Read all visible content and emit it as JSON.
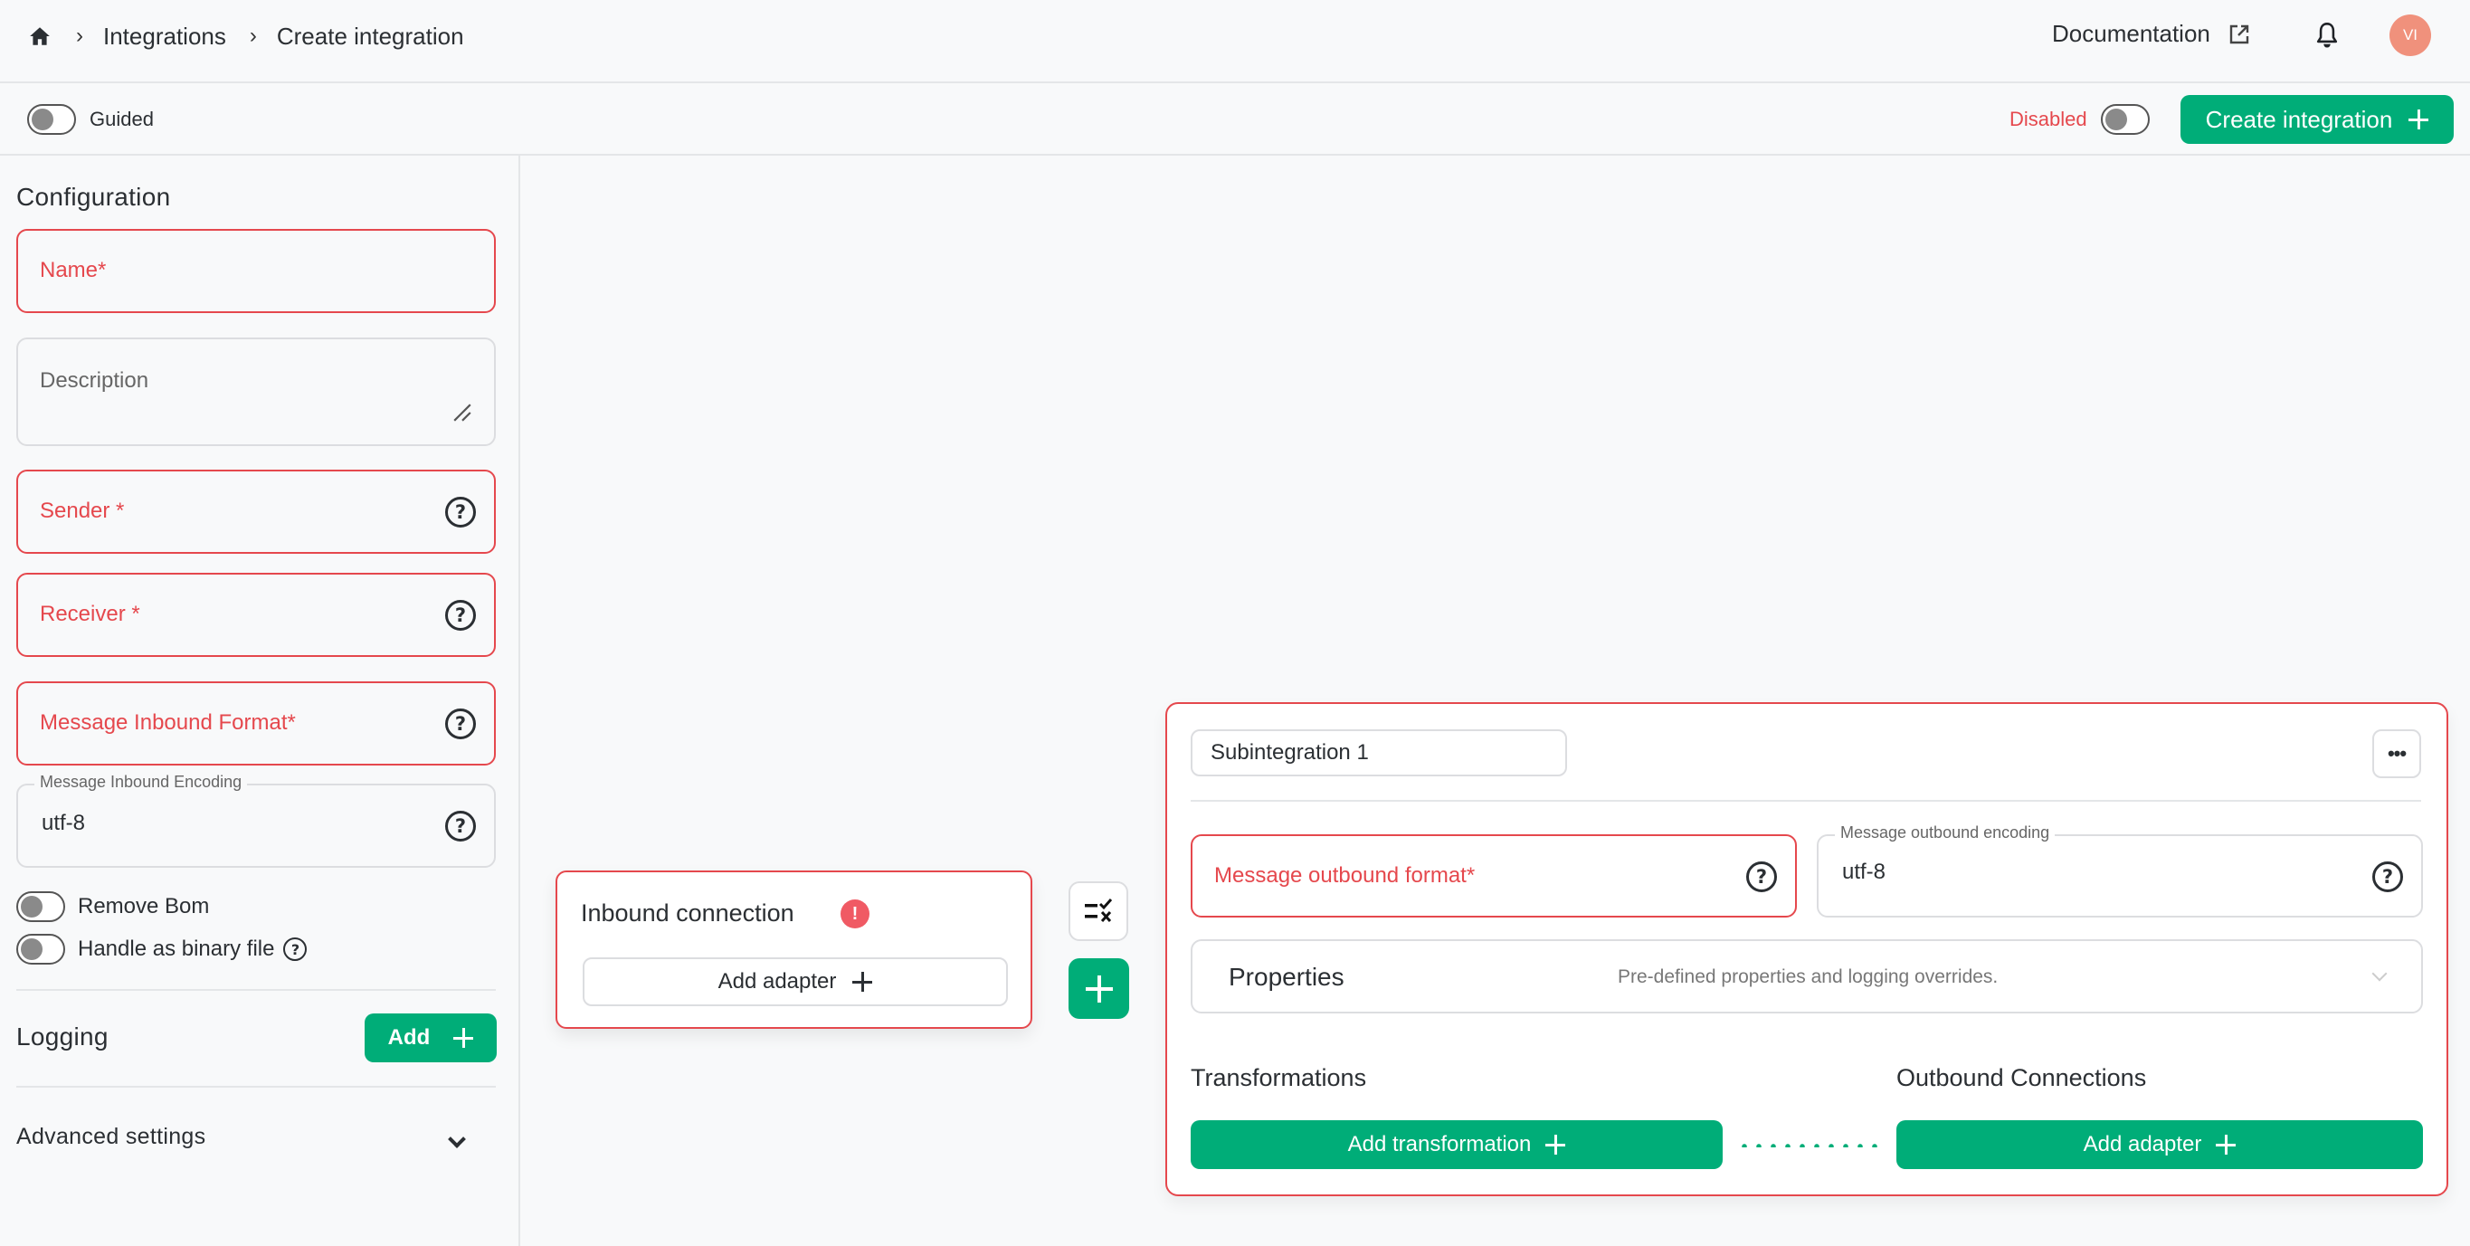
{
  "header": {
    "breadcrumb": [
      "Integrations",
      "Create integration"
    ],
    "documentation_label": "Documentation",
    "avatar_initials": "VI"
  },
  "toolbar": {
    "guided_label": "Guided",
    "guided_on": false,
    "status_label": "Disabled",
    "status_on": false,
    "create_button": "Create integration"
  },
  "sidebar": {
    "configuration_title": "Configuration",
    "fields": {
      "name_label": "Name*",
      "description_placeholder": "Description",
      "sender_label": "Sender *",
      "receiver_label": "Receiver *",
      "inbound_format_label": "Message Inbound Format*",
      "inbound_encoding_label": "Message Inbound Encoding",
      "inbound_encoding_value": "utf-8"
    },
    "switches": {
      "remove_bom": "Remove Bom",
      "binary_file": "Handle as binary file"
    },
    "logging_title": "Logging",
    "logging_add": "Add",
    "advanced_settings": "Advanced settings"
  },
  "canvas": {
    "inbound": {
      "title": "Inbound connection",
      "add_adapter": "Add adapter"
    },
    "subintegration": {
      "name": "Subintegration 1",
      "outbound_format_label": "Message outbound format*",
      "outbound_encoding_label": "Message outbound encoding",
      "outbound_encoding_value": "utf-8",
      "properties_title": "Properties",
      "properties_desc": "Pre-defined properties and logging overrides.",
      "transformations_title": "Transformations",
      "add_transformation": "Add transformation",
      "outbound_title": "Outbound Connections",
      "add_adapter": "Add adapter"
    }
  },
  "colors": {
    "accent": "#00ad78",
    "error": "#e5484d",
    "avatar": "#f0917c"
  }
}
